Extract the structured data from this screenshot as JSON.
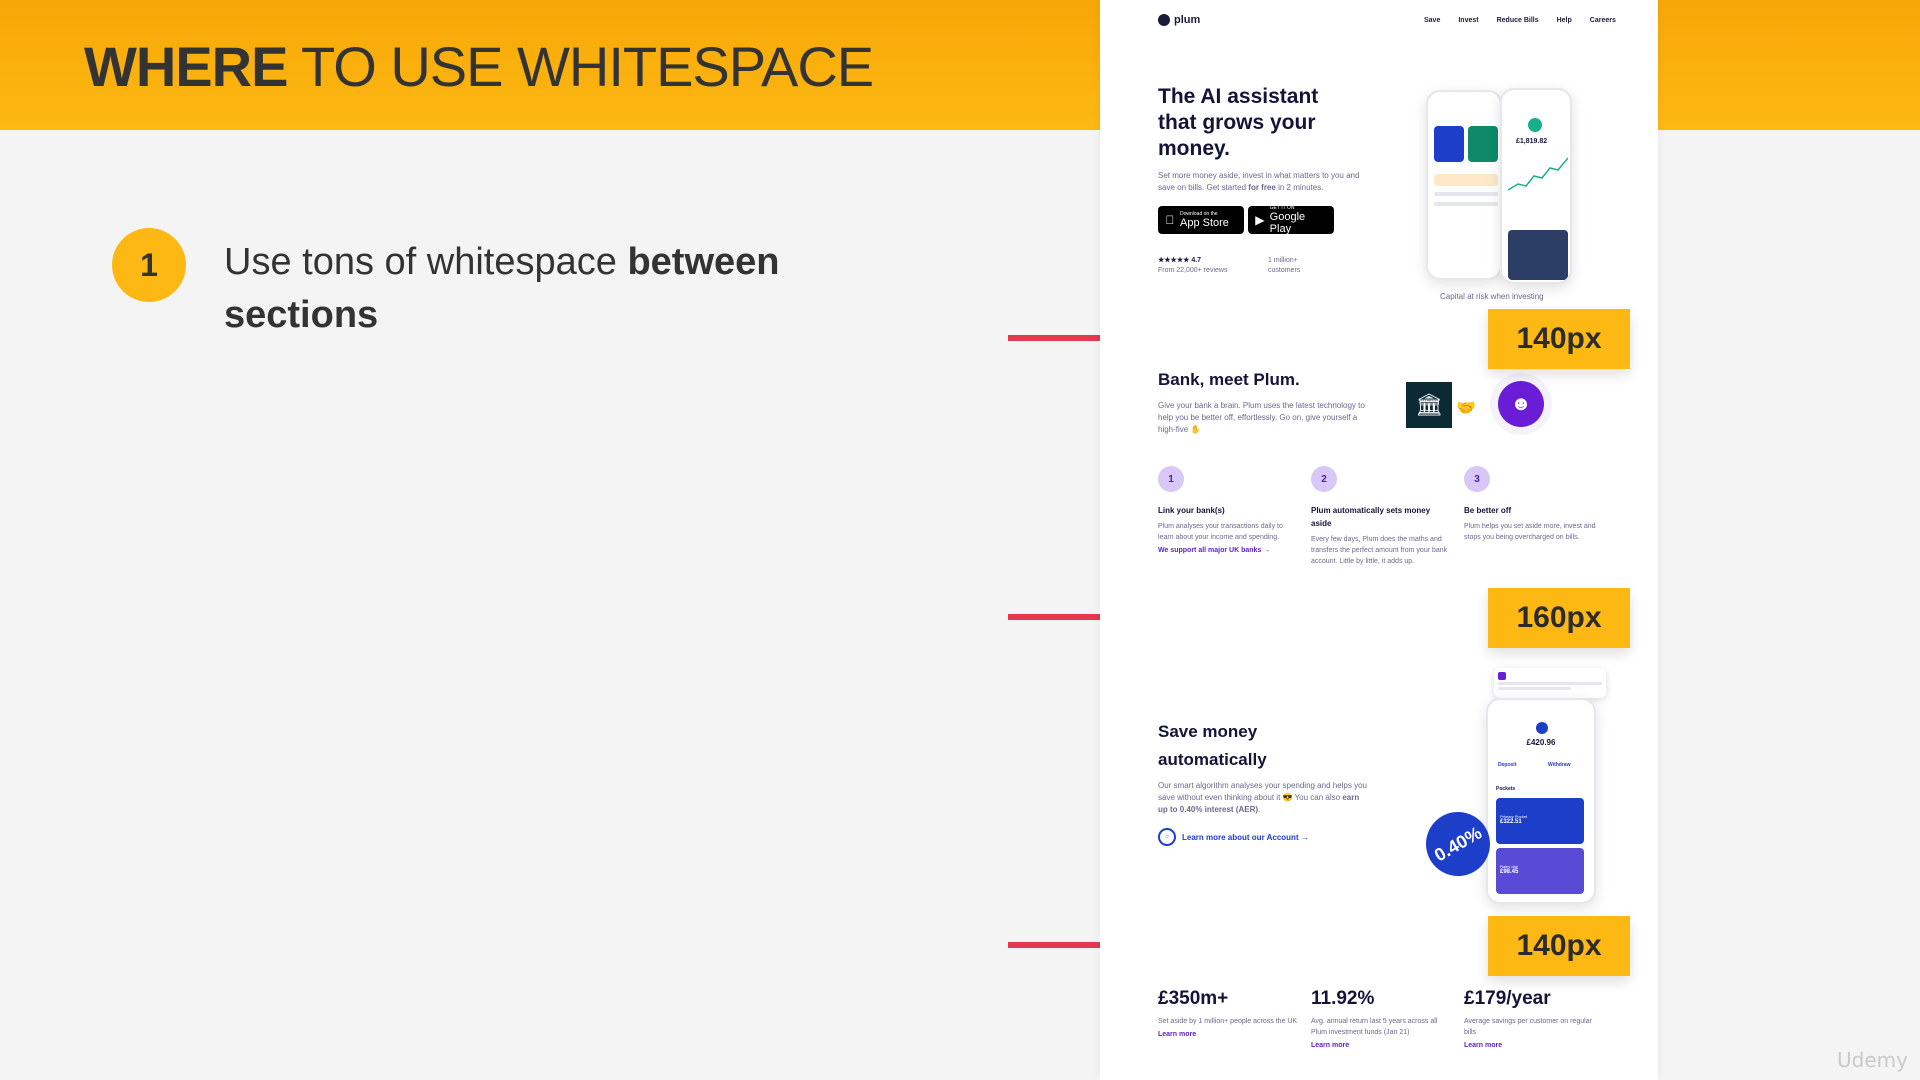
{
  "slide": {
    "title_bold": "WHERE",
    "title_rest": "TO USE WHITESPACE",
    "point_number": "1",
    "point_text": "Use tons of whitespace",
    "point_bold": "between sections"
  },
  "spacing_tags": [
    "140px",
    "160px",
    "140px"
  ],
  "site": {
    "logo": "plum",
    "nav": [
      "Save",
      "Invest",
      "Reduce Bills",
      "Help",
      "Careers"
    ],
    "hero": {
      "title": "The AI assistant that grows your money.",
      "desc_pre": "Set more money aside, invest in what matters to you and save on bills. Get started",
      "desc_bold": "for free",
      "desc_post": "in 2 minutes.",
      "appstore_small": "Download on the",
      "appstore_big": "App Store",
      "gplay_small": "GET IT ON",
      "gplay_big": "Google Play",
      "rating": "4.7",
      "rating_sub": "From 22,000+ reviews",
      "customers": "1 million+",
      "customers_sub": "customers",
      "phone_value": "£1,819.82",
      "capital_note": "Capital at risk when investing"
    },
    "bank": {
      "title": "Bank, meet Plum.",
      "desc": "Give your bank a brain. Plum uses the latest technology to help you be better off, effortlessly. Go on, give yourself a high-five ✋"
    },
    "steps": [
      {
        "num": "1",
        "title": "Link your bank(s)",
        "body": "Plum analyses your transactions daily to learn about your income and spending.",
        "link": "We support all major UK banks →"
      },
      {
        "num": "2",
        "title": "Plum automatically sets money aside",
        "body": "Every few days, Plum does the maths and transfers the perfect amount from your bank account. Little by little, it adds up.",
        "link": ""
      },
      {
        "num": "3",
        "title": "Be better off",
        "body": "Plum helps you set aside more, invest and stops you being overcharged on bills.",
        "link": ""
      }
    ],
    "save": {
      "title": "Save money automatically",
      "desc_pre": "Our smart algorithm analyses your spending and helps you save without even thinking about it 😎 You can also",
      "desc_bold": "earn up to 0.40% interest (AER)",
      "desc_post": ".",
      "link": "Learn more about our Account →",
      "balance": "£420.96",
      "pocket1_label": "Primary Pocket",
      "pocket1_value": "£322.51",
      "pocket2_label": "Rainy day",
      "pocket2_value": "£98.45",
      "interest_badge": "0.40%",
      "pockets_label": "Pockets",
      "deposit": "Deposit",
      "withdraw": "Withdraw"
    },
    "stats": [
      {
        "value": "£350m+",
        "desc": "Set aside by 1 million+ people across the UK",
        "more": "Learn more"
      },
      {
        "value": "11.92%",
        "desc": "Avg. annual return last 5 years across all Plum investment funds (Jan 21)",
        "more": "Learn more"
      },
      {
        "value": "£179/year",
        "desc": "Average savings per customer on regular bills",
        "more": "Learn more"
      }
    ]
  },
  "watermark": "Udemy",
  "colors": {
    "accent": "#fdb813",
    "arrow": "#e5384e",
    "plum_purple": "#6b1cd6",
    "plum_blue": "#1c3ec9"
  }
}
